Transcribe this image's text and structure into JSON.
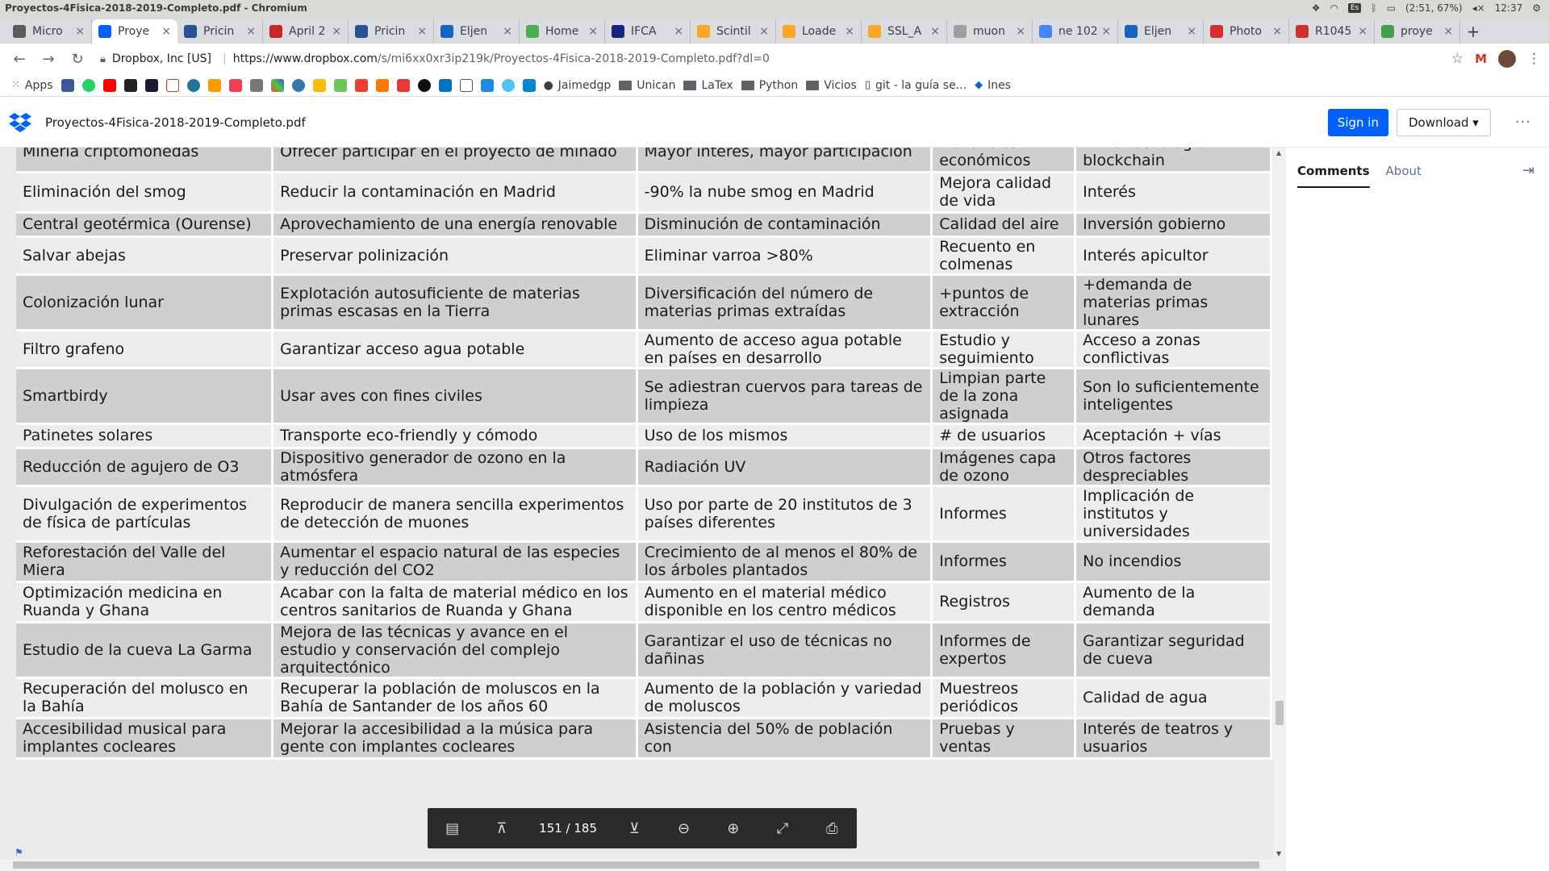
{
  "os": {
    "window_title": "Proyectos-4Fisica-2018-2019-Completo.pdf - Chromium",
    "kb_lang": "Es",
    "battery": "(2:51, 67%)",
    "clock": "12:37"
  },
  "tabs": [
    {
      "label": "Micro",
      "color": "#5a5a5a"
    },
    {
      "label": "Proye",
      "color": "#0061fe"
    },
    {
      "label": "Pricin",
      "color": "#2a5298"
    },
    {
      "label": "April 2",
      "color": "#c62828"
    },
    {
      "label": "Pricin",
      "color": "#2a5298"
    },
    {
      "label": "Eljen",
      "color": "#1565c0"
    },
    {
      "label": "Home",
      "color": "#4caf50"
    },
    {
      "label": "IFCA",
      "color": "#1a237e"
    },
    {
      "label": "Scintil",
      "color": "#f9a825"
    },
    {
      "label": "Loade",
      "color": "#f9a825"
    },
    {
      "label": "SSL_A",
      "color": "#f9a825"
    },
    {
      "label": "muon",
      "color": "#9e9e9e"
    },
    {
      "label": "ne 102",
      "color": "#4285f4"
    },
    {
      "label": "Eljen",
      "color": "#1565c0"
    },
    {
      "label": "Photo",
      "color": "#d32f2f"
    },
    {
      "label": "R1045",
      "color": "#d32f2f"
    },
    {
      "label": "proye",
      "color": "#43a047"
    }
  ],
  "address": {
    "org": "Dropbox, Inc [US]",
    "host": "https://www.dropbox.com",
    "path": "/s/mi6xx0xr3ip219k/Proyectos-4Fisica-2018-2019-Completo.pdf?dl=0"
  },
  "bookmarks": {
    "apps": "Apps",
    "jaimedgp": "Jaimedgp",
    "unican": "Unican",
    "latex": "LaTex",
    "python": "Python",
    "vicios": "Vicios",
    "git": "git - la guía se...",
    "ines": "Ines"
  },
  "dropbox": {
    "filename": "Proyectos-4Fisica-2018-2019-Completo.pdf",
    "signin": "Sign in",
    "download": "Download ▾",
    "more": "···"
  },
  "sidepanel": {
    "comments": "Comments",
    "about": "About"
  },
  "pdf": {
    "pages": "151 / 185",
    "rows": [
      [
        "Minería criptomonedas",
        "Ofrecer participar en el proyecto de minado",
        "Mayor interés, mayor participación",
        "Beneficios económicos",
        "Éxito tecnología blockchain"
      ],
      [
        "Eliminación del smog",
        "Reducir la contaminación en Madrid",
        "-90% la nube smog en Madrid",
        "Mejora calidad de vida",
        "Interés"
      ],
      [
        "Central geotérmica (Ourense)",
        "Aprovechamiento de una energía renovable",
        "Disminución de contaminación",
        "Calidad del aire",
        "Inversión gobierno"
      ],
      [
        "Salvar abejas",
        "Preservar polinización",
        "Eliminar varroa >80%",
        "Recuento en colmenas",
        "Interés apicultor"
      ],
      [
        "Colonización lunar",
        "Explotación autosuficiente de materias primas escasas en la Tierra",
        "Diversificación del número de materias primas extraídas",
        "+puntos de extracción",
        "+demanda de materias primas lunares"
      ],
      [
        "Filtro grafeno",
        "Garantizar acceso agua potable",
        "Aumento de acceso agua potable en países en desarrollo",
        "Estudio y seguimiento",
        "Acceso a zonas conflictivas"
      ],
      [
        "Smartbirdy",
        "Usar aves con fines civiles",
        "Se adiestran cuervos para tareas de limpieza",
        "Limpian parte de la zona asignada",
        "Son lo suficientemente inteligentes"
      ],
      [
        "Patinetes solares",
        "Transporte eco-friendly y cómodo",
        "Uso de los mismos",
        "# de usuarios",
        "Aceptación + vías"
      ],
      [
        "Reducción de agujero de O3",
        "Dispositivo generador de ozono en la atmósfera",
        "Radiación UV",
        "Imágenes capa de ozono",
        "Otros factores despreciables"
      ],
      [
        "Divulgación de experimentos de física de partículas",
        "Reproducir de manera sencilla experimentos de detección de muones",
        "Uso por parte de 20 institutos de 3 países diferentes",
        "Informes",
        "Implicación de institutos y universidades"
      ],
      [
        "Reforestación del Valle del Miera",
        "Aumentar el espacio natural de las especies y reducción del CO2",
        "Crecimiento de al menos el 80% de los árboles plantados",
        "Informes",
        "No incendios"
      ],
      [
        "Optimización medicina en Ruanda y Ghana",
        "Acabar con la falta de material médico en los centros sanitarios de Ruanda y Ghana",
        "Aumento en el material médico disponible en los centro médicos",
        "Registros",
        "Aumento de la demanda"
      ],
      [
        "Estudio de la cueva La Garma",
        "Mejora de las técnicas y avance en el estudio y conservación del complejo arquitectónico",
        "Garantizar el uso de técnicas no dañinas",
        "Informes de expertos",
        "Garantizar seguridad de cueva"
      ],
      [
        "Recuperación del molusco en la Bahía",
        "Recuperar la población de moluscos en la Bahía de Santander de los años 60",
        "Aumento de la población y variedad de moluscos",
        "Muestreos periódicos",
        "Calidad de agua"
      ],
      [
        "Accesibilidad musical para implantes cocleares",
        "Mejorar la accesibilidad a la música para gente con implantes cocleares",
        "Asistencia del 50% de población con",
        "Pruebas y ventas",
        "Interés de teatros y usuarios"
      ]
    ]
  }
}
